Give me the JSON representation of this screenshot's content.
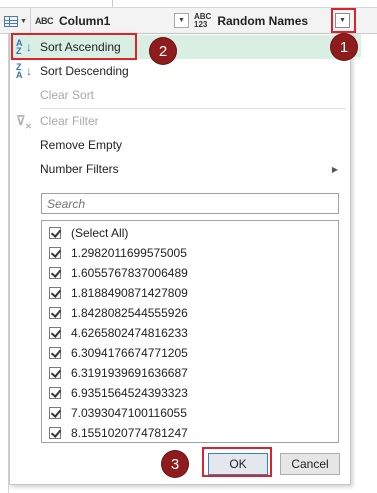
{
  "header": {
    "column1_type": "ABC",
    "column1_name": "Column1",
    "column2_type_top": "ABC",
    "column2_type_bottom": "123",
    "column2_name": "Random Names"
  },
  "menu": {
    "sort_ascending": "Sort Ascending",
    "sort_descending": "Sort Descending",
    "clear_sort": "Clear Sort",
    "clear_filter": "Clear Filter",
    "remove_empty": "Remove Empty",
    "number_filters": "Number Filters"
  },
  "search": {
    "placeholder": "Search"
  },
  "values": {
    "items": [
      "(Select All)",
      "1.2982011699575005",
      "1.6055767837006489",
      "1.8188490871427809",
      "1.842808254455592​6",
      "4.6265802474816233",
      "6.3094176674771205",
      "6.3191939691636687",
      "6.9351564524393323",
      "7.0393047100116055",
      "8.1551020774781247"
    ]
  },
  "buttons": {
    "ok": "OK",
    "cancel": "Cancel"
  },
  "callouts": {
    "one": "1",
    "two": "2",
    "three": "3"
  },
  "colors": {
    "highlight": "#d9efe3",
    "callout_border": "#d9242d",
    "callout_badge": "#8e1c1c"
  }
}
